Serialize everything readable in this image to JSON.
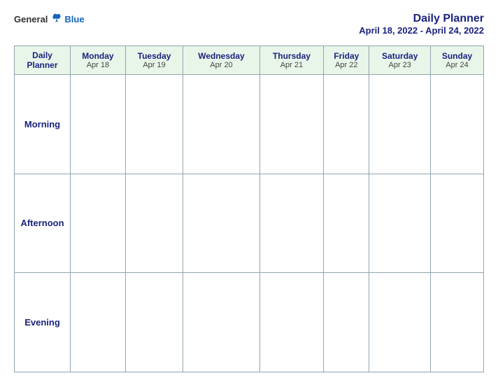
{
  "header": {
    "logo_general": "General",
    "logo_blue": "Blue",
    "title": "Daily Planner",
    "dates": "April 18, 2022 - April 24, 2022"
  },
  "table": {
    "corner_label_line1": "Daily",
    "corner_label_line2": "Planner",
    "columns": [
      {
        "day": "Monday",
        "date": "Apr 18"
      },
      {
        "day": "Tuesday",
        "date": "Apr 19"
      },
      {
        "day": "Wednesday",
        "date": "Apr 20"
      },
      {
        "day": "Thursday",
        "date": "Apr 21"
      },
      {
        "day": "Friday",
        "date": "Apr 22"
      },
      {
        "day": "Saturday",
        "date": "Apr 23"
      },
      {
        "day": "Sunday",
        "date": "Apr 24"
      }
    ],
    "rows": [
      {
        "label": "Morning"
      },
      {
        "label": "Afternoon"
      },
      {
        "label": "Evening"
      }
    ]
  }
}
